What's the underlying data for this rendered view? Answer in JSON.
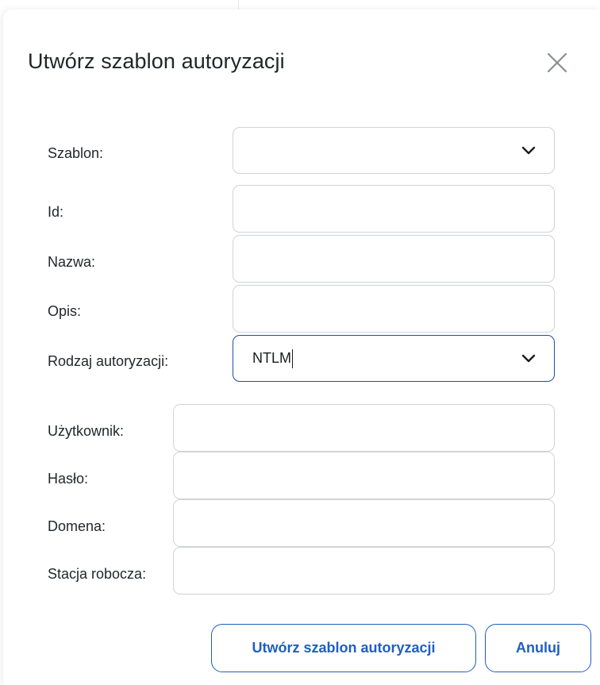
{
  "dialog": {
    "title": "Utwórz szablon autoryzacji"
  },
  "form": {
    "template": {
      "label": "Szablon:",
      "value": ""
    },
    "id": {
      "label": "Id:",
      "value": ""
    },
    "name": {
      "label": "Nazwa:",
      "value": ""
    },
    "description": {
      "label": "Opis:",
      "value": ""
    },
    "auth_type": {
      "label": "Rodzaj autoryzacji:",
      "value": "NTLM"
    },
    "user": {
      "label": "Użytkownik:",
      "value": ""
    },
    "password": {
      "label": "Hasło:",
      "value": ""
    },
    "domain": {
      "label": "Domena:",
      "value": ""
    },
    "workstation": {
      "label": "Stacja robocza:",
      "value": ""
    }
  },
  "buttons": {
    "create_label": "Utwórz szablon autoryzacji",
    "cancel_label": "Anuluj"
  },
  "colors": {
    "accent": "#1f5fbf",
    "focus_border": "#1f4f9c",
    "field_border": "#d0d3d7"
  },
  "icons": [
    "close-icon",
    "chevron-down-icon"
  ]
}
